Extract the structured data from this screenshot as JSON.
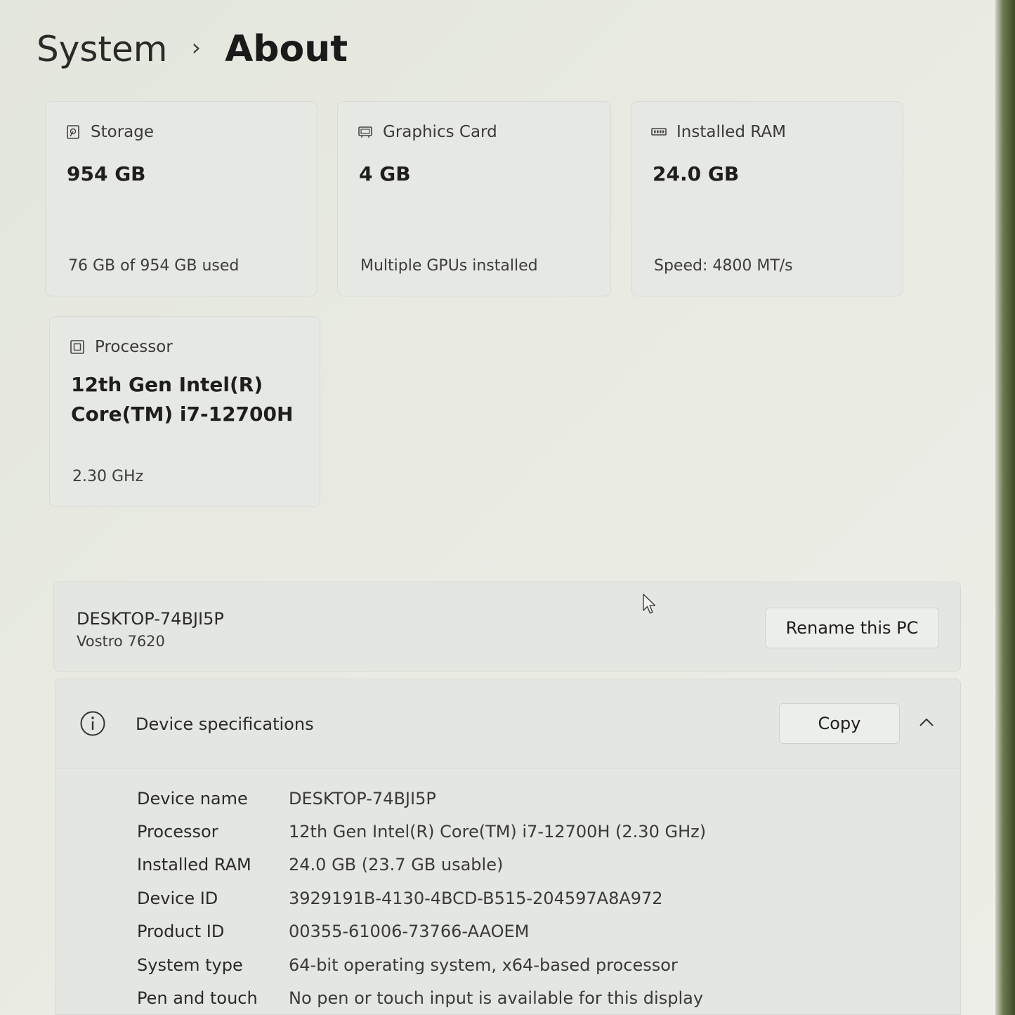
{
  "breadcrumb": {
    "parent": "System",
    "separator": "›",
    "current": "About"
  },
  "cards": {
    "storage": {
      "title": "Storage",
      "value": "954 GB",
      "sub": "76 GB of 954 GB used",
      "icon": "storage-icon"
    },
    "graphics": {
      "title": "Graphics Card",
      "value": "4 GB",
      "sub": "Multiple GPUs installed",
      "icon": "gpu-icon"
    },
    "ram": {
      "title": "Installed RAM",
      "value": "24.0 GB",
      "sub": "Speed: 4800 MT/s",
      "icon": "ram-icon"
    },
    "processor": {
      "title": "Processor",
      "value_line1": "12th Gen Intel(R)",
      "value_line2": "Core(TM) i7-12700H",
      "sub": "2.30 GHz",
      "icon": "processor-icon"
    }
  },
  "pc": {
    "name": "DESKTOP-74BJI5P",
    "model": "Vostro 7620",
    "rename_label": "Rename this PC"
  },
  "specs": {
    "title": "Device specifications",
    "copy_label": "Copy",
    "rows": [
      {
        "label": "Device name",
        "value": "DESKTOP-74BJI5P"
      },
      {
        "label": "Processor",
        "value": "12th Gen Intel(R) Core(TM) i7-12700H (2.30 GHz)"
      },
      {
        "label": "Installed RAM",
        "value": "24.0 GB (23.7 GB usable)"
      },
      {
        "label": "Device ID",
        "value": "3929191B-4130-4BCD-B515-204597A8A972"
      },
      {
        "label": "Product ID",
        "value": "00355-61006-73766-AAOEM"
      },
      {
        "label": "System type",
        "value": "64-bit operating system, x64-based processor"
      },
      {
        "label": "Pen and touch",
        "value": "No pen or touch input is available for this display"
      }
    ]
  },
  "colors": {
    "card_bg": "#e6e8e4",
    "page_bg": "#e9ebe3",
    "text": "#1c1c1c"
  }
}
